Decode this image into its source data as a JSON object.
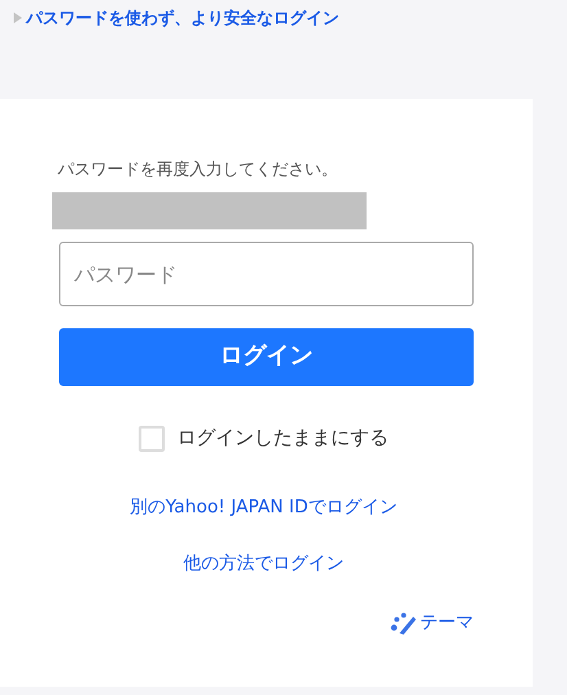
{
  "top_link": {
    "label": "パスワードを使わず、より安全なログイン"
  },
  "prompt": "パスワードを再度入力してください。",
  "password_field": {
    "placeholder": "パスワード"
  },
  "login_button": {
    "label": "ログイン"
  },
  "keep_logged_in": {
    "label": "ログインしたままにする",
    "checked": false
  },
  "links": [
    "別のYahoo! JAPAN IDでログイン",
    "他の方法でログイン"
  ],
  "theme_link": {
    "label": "テーマ"
  }
}
